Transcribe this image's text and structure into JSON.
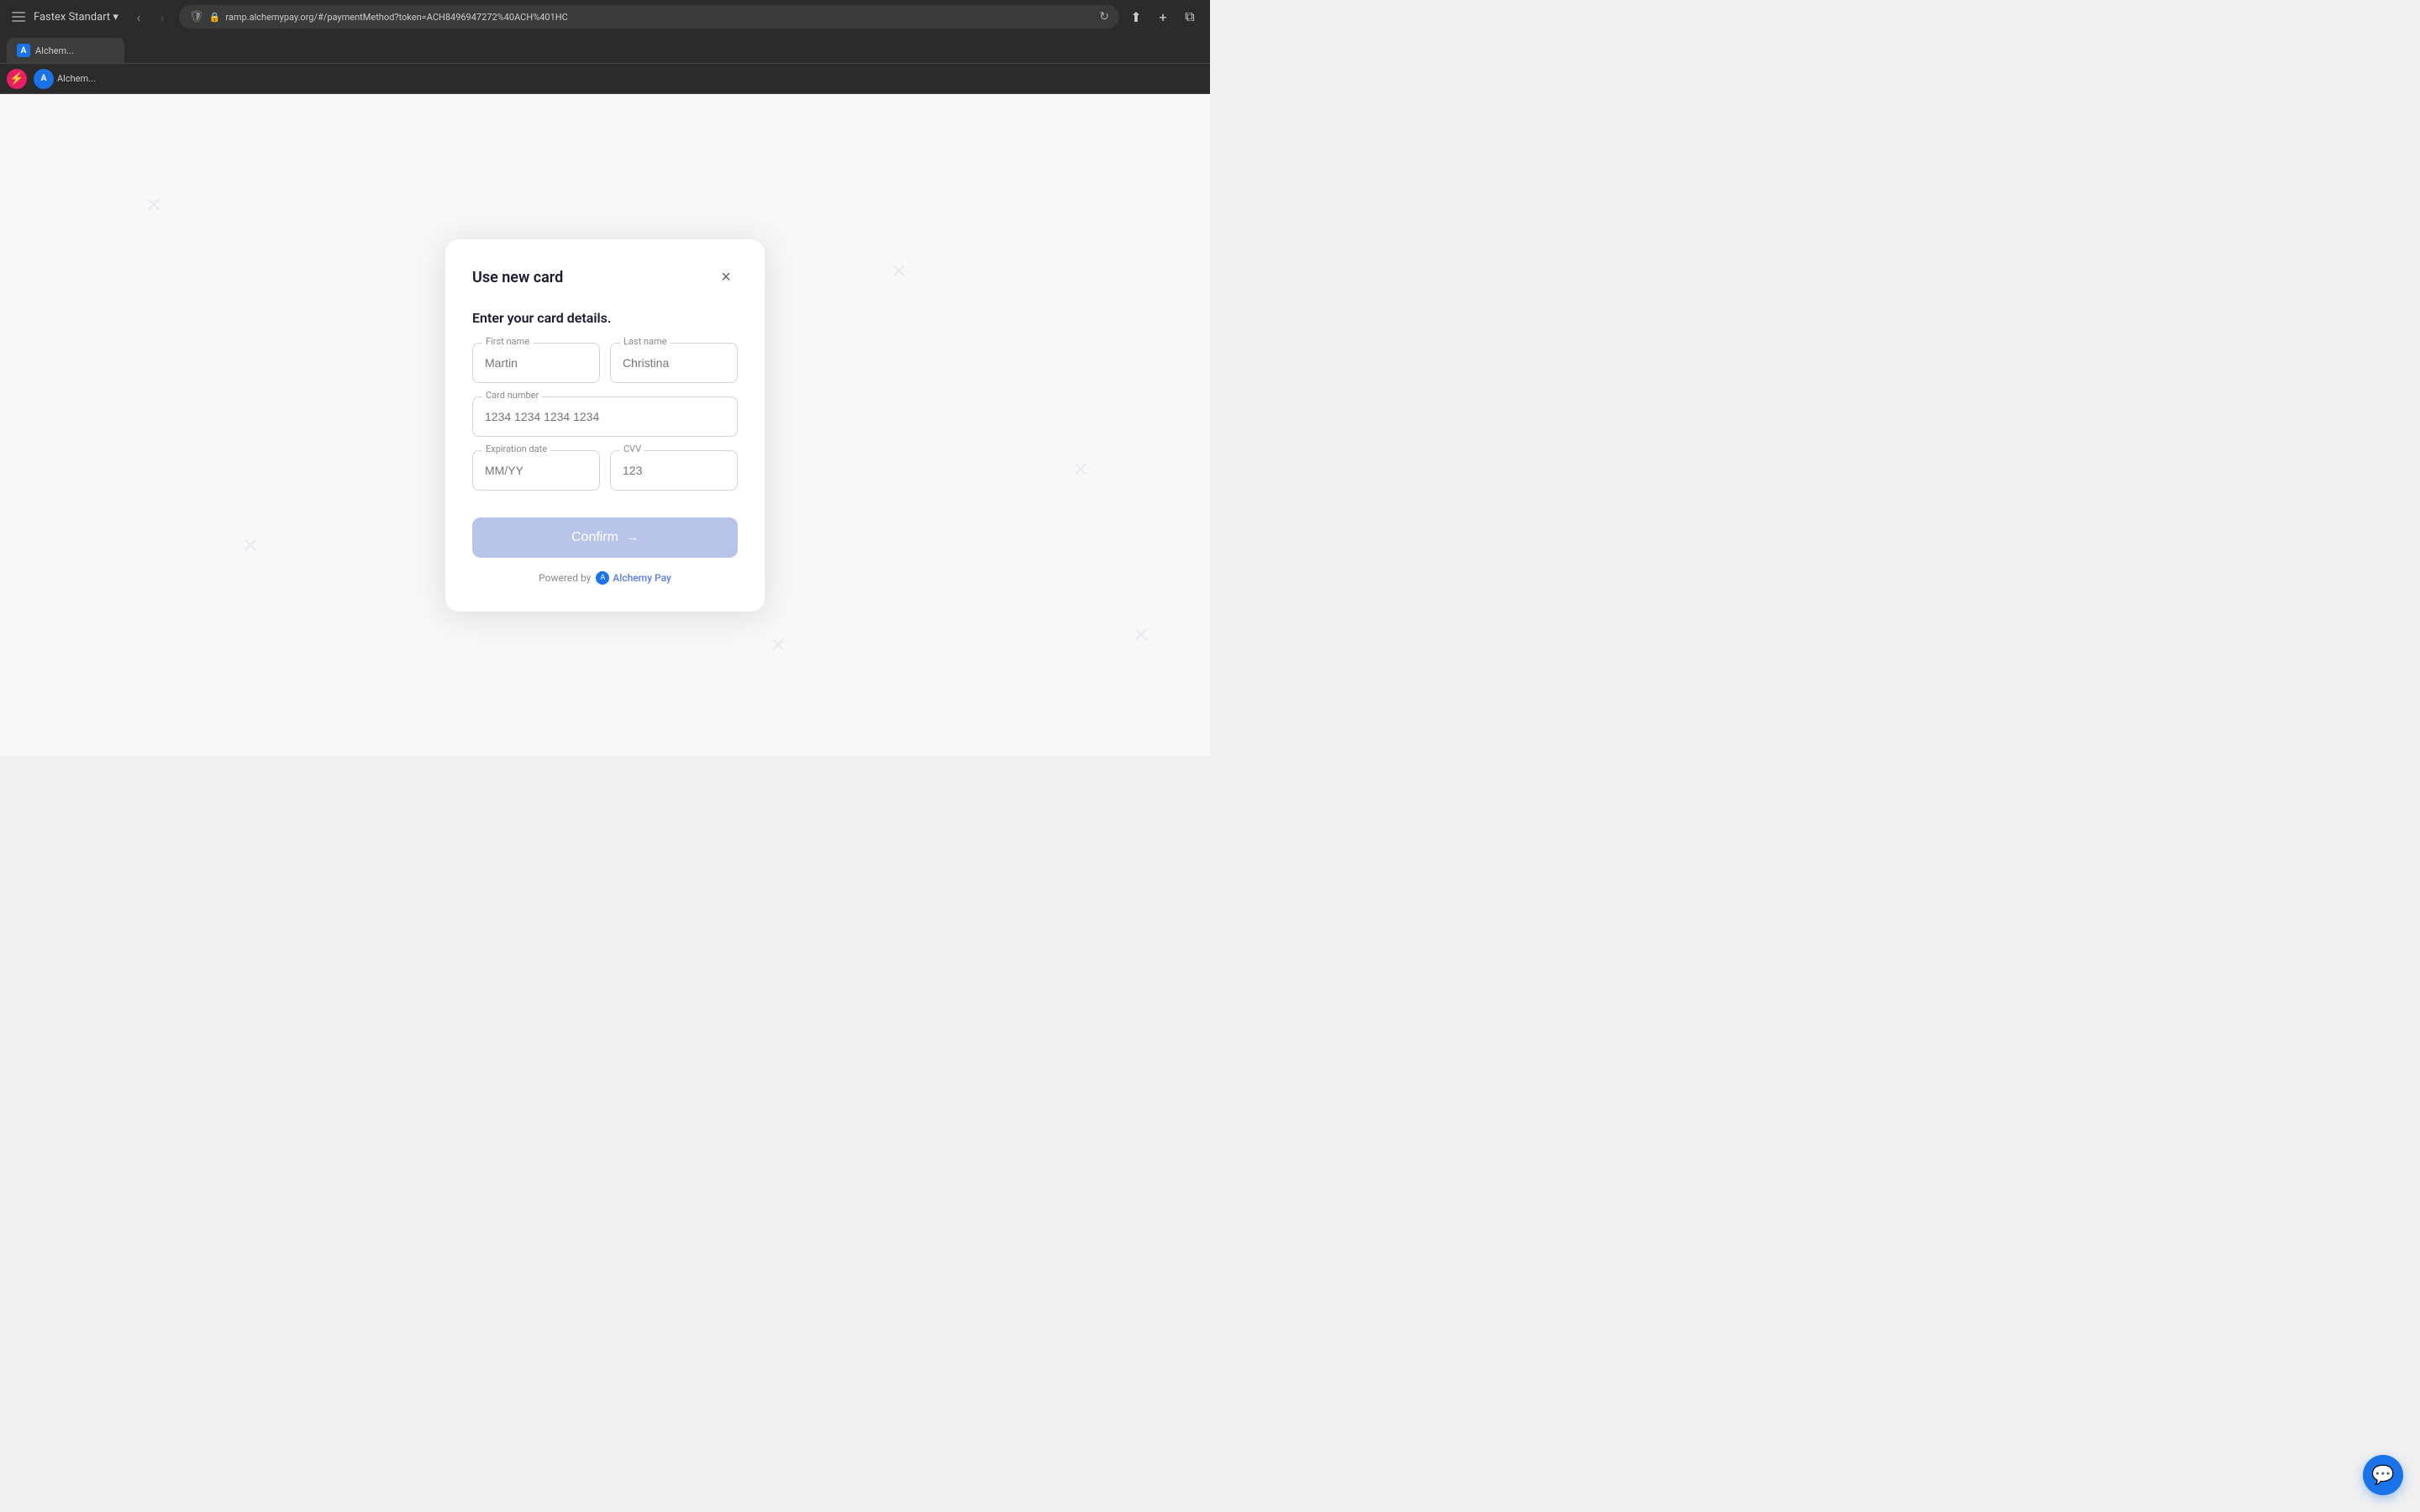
{
  "browser": {
    "url": "ramp.alchemypay.org/#/paymentMethod?token=ACH8496947272%40ACH%401HC",
    "tab_title": "Alchem...",
    "back_disabled": false,
    "forward_disabled": true
  },
  "modal": {
    "title": "Use new card",
    "subtitle": "Enter your card details.",
    "close_label": "×",
    "fields": {
      "first_name_label": "First name",
      "first_name_placeholder": "Martin",
      "last_name_label": "Last name",
      "last_name_placeholder": "Christina",
      "card_number_label": "Card number",
      "card_number_placeholder": "1234 1234 1234 1234",
      "expiration_label": "Expiration date",
      "expiration_placeholder": "MM/YY",
      "cvv_label": "CVV",
      "cvv_placeholder": "123"
    },
    "confirm_button": "Confirm",
    "confirm_arrow": "→",
    "powered_by_text": "Powered by",
    "alchemy_pay_text": "Alchemy Pay"
  }
}
